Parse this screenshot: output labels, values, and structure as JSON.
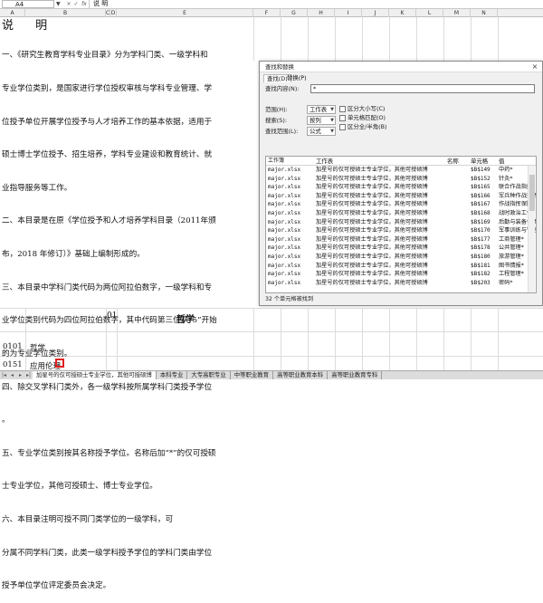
{
  "formula_bar": {
    "name_box": "A4",
    "formula_text": "说  明",
    "fx_buttons": [
      "×",
      "✓",
      "fx"
    ]
  },
  "columns": [
    "A",
    "B",
    "C",
    "D",
    "E",
    "F",
    "G",
    "H",
    "I",
    "J",
    "K",
    "L",
    "M",
    "N"
  ],
  "sheet": {
    "title": "说  明",
    "paragraph_lines": [
      "一、《研究生教育学科专业目录》分为学科门类、一级学科和",
      "专业学位类别，是国家进行学位授权审核与学科专业管理、学",
      "位授予单位开展学位授予与人才培养工作的基本依据，适用于",
      "硕士博士学位授予、招生培养，学科专业建设和教育统计、就",
      "业指导服务等工作。",
      "二、本目录是在原《学位授予和人才培养学科目录（2011年颁",
      "布，2018 年修订）》基础上编制形成的。",
      "三、本目录中学科门类代码为两位阿拉伯数字，一级学科和专",
      "业学位类别代码为四位阿拉伯数字，其中代码第三位从“5”开始",
      "的为专业学位类别。",
      "四、除交叉学科门类外，各一级学科按所属学科门类授予学位",
      "。",
      "五、专业学位类别按其名称授予学位。名称后加“*”的仅可授硕",
      "士专业学位，其他可授硕士、博士专业学位。",
      "六、本目录注明可授不同门类学位的一级学科，可",
      "分属不同学科门类，此类一级学科授予学位的学科门类由学位",
      "授予单位学位评定委员会决定。"
    ],
    "row_code_01": "01",
    "row_category_01": "哲学",
    "row_0101_code": "0101",
    "row_0101_name": "哲学",
    "row_0151_code": "0151",
    "row_0151_name": "应用伦理"
  },
  "sheet_tabs": [
    {
      "label": "加星号的仅可授硕士专业学位，其他可授硕博",
      "active": true
    },
    {
      "label": "本科专业",
      "active": false
    },
    {
      "label": "大专高职专业",
      "active": false
    },
    {
      "label": "中等职业教育",
      "active": false
    },
    {
      "label": "高等职业教育本科",
      "active": false
    },
    {
      "label": "高等职业教育专科",
      "active": false
    }
  ],
  "find_dialog": {
    "title": "查找和替换",
    "close_glyph": "×",
    "tabs": [
      "查找(D)",
      "替换(P)"
    ],
    "find_label": "查找内容(N):",
    "find_value": "*",
    "scope_label": "范围(H):",
    "scope_value": "工作表",
    "search_label": "搜索(S):",
    "search_value": "按列",
    "lookin_label": "查找范围(L):",
    "lookin_value": "公式",
    "options": [
      "区分大小写(C)",
      "单元格匹配(O)",
      "区分全/半角(B)"
    ],
    "columns": [
      "工作簿",
      "工作表",
      "名称",
      "单元格",
      "值"
    ],
    "rows": [
      {
        "book": "major.xlsx",
        "sheet": "加星号的仅可授硕士专业学位，其他可授硕博",
        "cell": "$B$149",
        "value": "中药*"
      },
      {
        "book": "major.xlsx",
        "sheet": "加星号的仅可授硕士专业学位，其他可授硕博",
        "cell": "$B$152",
        "value": "针灸*"
      },
      {
        "book": "major.xlsx",
        "sheet": "加星号的仅可授硕士专业学位，其他可授硕博",
        "cell": "$B$165",
        "value": "联合作战指挥*"
      },
      {
        "book": "major.xlsx",
        "sheet": "加星号的仅可授硕士专业学位，其他可授硕博",
        "cell": "$B$166",
        "value": "军兵种作战指挥*"
      },
      {
        "book": "major.xlsx",
        "sheet": "加星号的仅可授硕士专业学位，其他可授硕博",
        "cell": "$B$167",
        "value": "作战指挥保障*"
      },
      {
        "book": "major.xlsx",
        "sheet": "加星号的仅可授硕士专业学位，其他可授硕博",
        "cell": "$B$168",
        "value": "战时政治工作*"
      },
      {
        "book": "major.xlsx",
        "sheet": "加星号的仅可授硕士专业学位，其他可授硕博",
        "cell": "$B$169",
        "value": "后勤与装备保障*"
      },
      {
        "book": "major.xlsx",
        "sheet": "加星号的仅可授硕士专业学位，其他可授硕博",
        "cell": "$B$170",
        "value": "军事训练与管理*"
      },
      {
        "book": "major.xlsx",
        "sheet": "加星号的仅可授硕士专业学位，其他可授硕博",
        "cell": "$B$177",
        "value": "工商管理*"
      },
      {
        "book": "major.xlsx",
        "sheet": "加星号的仅可授硕士专业学位，其他可授硕博",
        "cell": "$B$178",
        "value": "公共管理*"
      },
      {
        "book": "major.xlsx",
        "sheet": "加星号的仅可授硕士专业学位，其他可授硕博",
        "cell": "$B$180",
        "value": "旅游管理*"
      },
      {
        "book": "major.xlsx",
        "sheet": "加星号的仅可授硕士专业学位，其他可授硕博",
        "cell": "$B$181",
        "value": "图书情报*"
      },
      {
        "book": "major.xlsx",
        "sheet": "加星号的仅可授硕士专业学位，其他可授硕博",
        "cell": "$B$182",
        "value": "工程管理*"
      },
      {
        "book": "major.xlsx",
        "sheet": "加星号的仅可授硕士专业学位，其他可授硕博",
        "cell": "$B$203",
        "value": "密码*"
      }
    ],
    "status": "32 个单元格被找到"
  }
}
